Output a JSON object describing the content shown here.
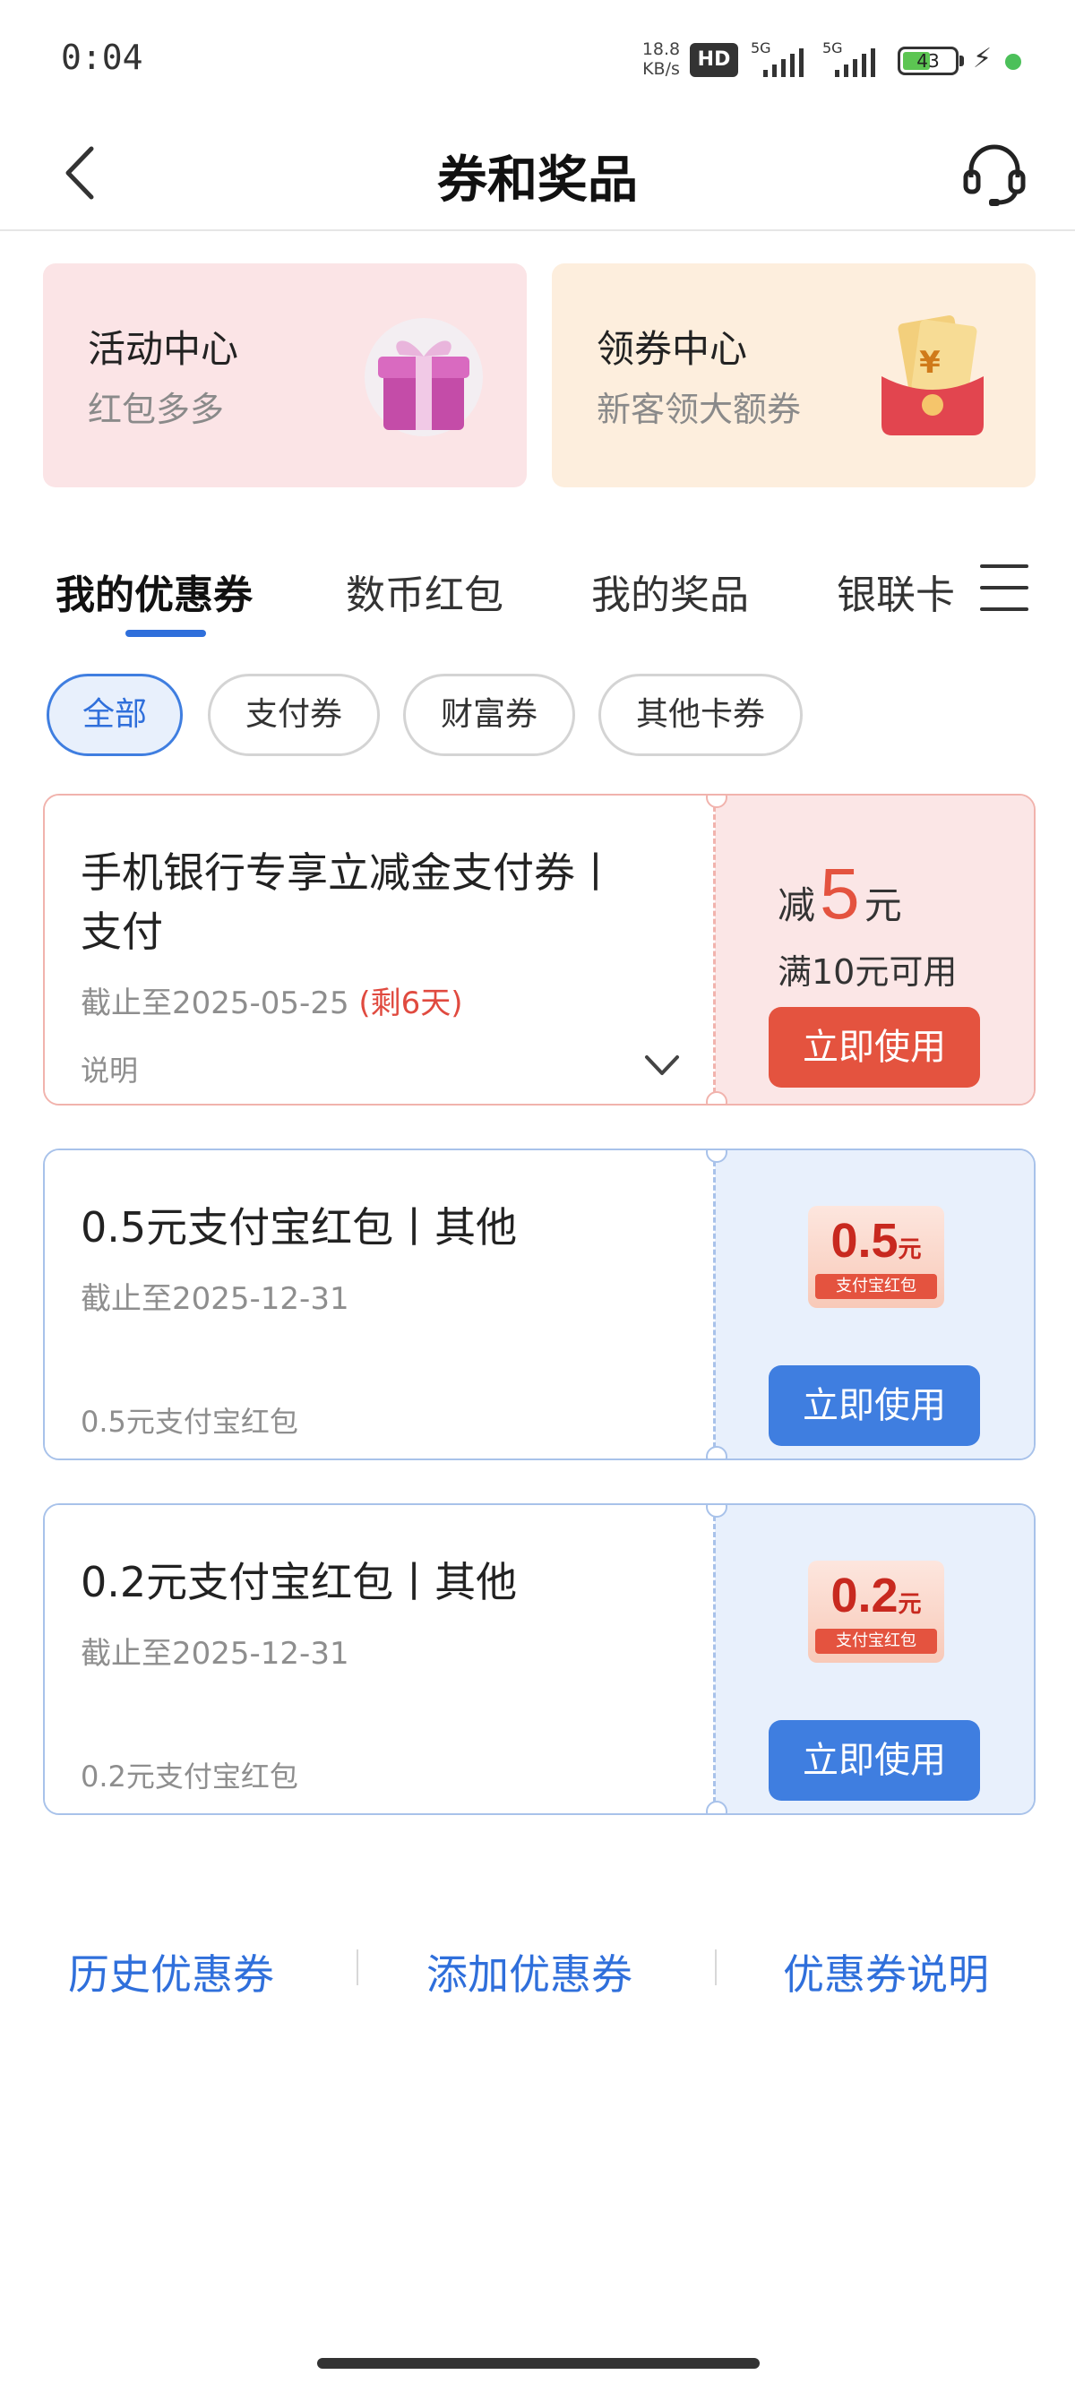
{
  "status_bar": {
    "time": "0:04",
    "net_speed_value": "18.8",
    "net_speed_unit": "KB/s",
    "hd_badge": "HD",
    "sim1_label": "5G",
    "sim2_label": "5G",
    "battery": "43"
  },
  "header": {
    "title": "券和奖品"
  },
  "promo_cards": [
    {
      "title": "活动中心",
      "subtitle": "红包多多"
    },
    {
      "title": "领券中心",
      "subtitle": "新客领大额券"
    }
  ],
  "tabs": [
    {
      "label": "我的优惠券"
    },
    {
      "label": "数币红包"
    },
    {
      "label": "我的奖品"
    },
    {
      "label": "银联卡"
    }
  ],
  "chips": [
    {
      "label": "全部"
    },
    {
      "label": "支付券"
    },
    {
      "label": "财富券"
    },
    {
      "label": "其他卡券"
    }
  ],
  "coupons": [
    {
      "title_line1": "手机银行专享立减金支付券丨",
      "title_line2": "支付",
      "deadline": "截止至2025-05-25",
      "remaining": "(剩6天)",
      "note": "说明",
      "discount_prefix": "减",
      "discount_value": "5",
      "discount_unit": "元",
      "condition": "满10元可用",
      "button": "立即使用"
    },
    {
      "title": "0.5元支付宝红包丨其他",
      "deadline": "截止至2025-12-31",
      "note": "0.5元支付宝红包",
      "badge_amount": "0.5",
      "badge_unit": "元",
      "badge_caption": "支付宝红包",
      "button": "立即使用"
    },
    {
      "title": "0.2元支付宝红包丨其他",
      "deadline": "截止至2025-12-31",
      "note": "0.2元支付宝红包",
      "badge_amount": "0.2",
      "badge_unit": "元",
      "badge_caption": "支付宝红包",
      "button": "立即使用"
    }
  ],
  "footer_links": [
    {
      "label": "历史优惠券"
    },
    {
      "label": "添加优惠券"
    },
    {
      "label": "优惠券说明"
    }
  ],
  "colors": {
    "accent_blue": "#2f6fdb",
    "button_red": "#e4533f",
    "button_blue": "#3f7ee0",
    "coupon_red_bg": "#fbe6e6",
    "coupon_blue_bg": "#e8f0fc"
  }
}
